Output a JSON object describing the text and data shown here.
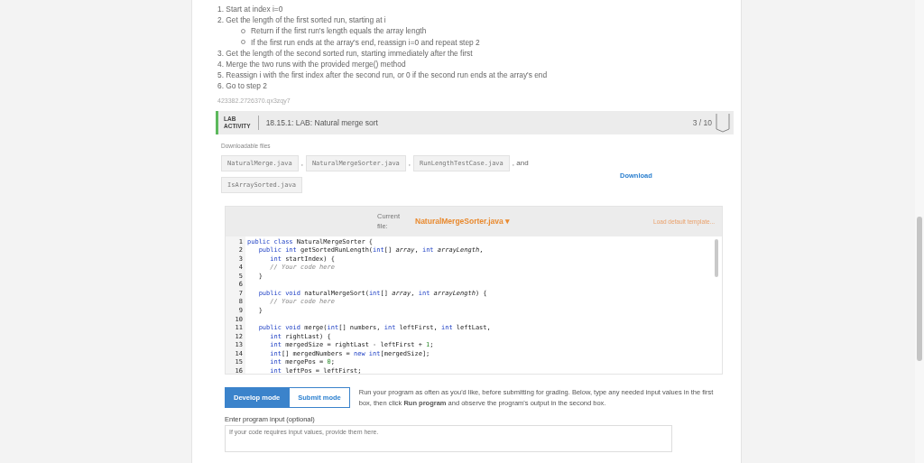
{
  "steps": [
    {
      "number": "1.",
      "text": "Start at index i=0"
    },
    {
      "number": "2.",
      "text": "Get the length of the first sorted run, starting at i",
      "sub": [
        "Return if the first run's length equals the array length",
        "If the first run ends at the array's end, reassign i=0 and repeat step 2"
      ]
    },
    {
      "number": "3.",
      "text": "Get the length of the second sorted run, starting immediately after the first"
    },
    {
      "number": "4.",
      "text": "Merge the two runs with the provided merge() method"
    },
    {
      "number": "5.",
      "text": "Reassign i with the first index after the second run, or 0 if the second run ends at the array's end"
    },
    {
      "number": "6.",
      "text": "Go to step 2"
    }
  ],
  "activity_id": "423382.2726370.qx3zqy7",
  "lab": {
    "badge_line1": "LAB",
    "badge_line2": "ACTIVITY",
    "title": "18.15.1: LAB: Natural merge sort",
    "score": "3 / 10"
  },
  "downloads": {
    "label": "Downloadable files",
    "files": [
      "NaturalMerge.java",
      "NaturalMergeSorter.java",
      "RunLengthTestCase.java",
      "IsArraySorted.java"
    ],
    "separators": [
      ",",
      ",",
      ", and"
    ],
    "button": "Download"
  },
  "editor": {
    "current_label": "Current file:",
    "file": "NaturalMergeSorter.java",
    "dropdown_caret": "▾",
    "load_template": "Load default template...",
    "lines": [
      {
        "number": "1",
        "tokens": [
          {
            "kind": "kw",
            "text": "public class "
          },
          {
            "kind": "plain",
            "text": "NaturalMergeSorter {"
          }
        ]
      },
      {
        "number": "2",
        "tokens": [
          {
            "kind": "kw",
            "text": "   public int "
          },
          {
            "kind": "plain",
            "text": "getSortedRunLength("
          },
          {
            "kind": "kw",
            "text": "int"
          },
          {
            "kind": "plain",
            "text": "[] "
          },
          {
            "kind": "var",
            "text": "array"
          },
          {
            "kind": "plain",
            "text": ", "
          },
          {
            "kind": "kw",
            "text": "int "
          },
          {
            "kind": "var",
            "text": "arrayLength"
          },
          {
            "kind": "plain",
            "text": ","
          }
        ]
      },
      {
        "number": "3",
        "tokens": [
          {
            "kind": "kw",
            "text": "      int "
          },
          {
            "kind": "plain",
            "text": "startIndex) {"
          }
        ]
      },
      {
        "number": "4",
        "tokens": [
          {
            "kind": "comment",
            "text": "      // Your code here"
          }
        ]
      },
      {
        "number": "5",
        "tokens": [
          {
            "kind": "plain",
            "text": "   }"
          }
        ]
      },
      {
        "number": "6"
      },
      {
        "number": "7",
        "tokens": [
          {
            "kind": "kw",
            "text": "   public void "
          },
          {
            "kind": "plain",
            "text": "naturalMergeSort("
          },
          {
            "kind": "kw",
            "text": "int"
          },
          {
            "kind": "plain",
            "text": "[] "
          },
          {
            "kind": "var",
            "text": "array"
          },
          {
            "kind": "plain",
            "text": ", "
          },
          {
            "kind": "kw",
            "text": "int "
          },
          {
            "kind": "var",
            "text": "arrayLength"
          },
          {
            "kind": "plain",
            "text": ") {"
          }
        ]
      },
      {
        "number": "8",
        "tokens": [
          {
            "kind": "comment",
            "text": "      // Your code here"
          }
        ]
      },
      {
        "number": "9",
        "tokens": [
          {
            "kind": "plain",
            "text": "   }"
          }
        ]
      },
      {
        "number": "10"
      },
      {
        "number": "11",
        "tokens": [
          {
            "kind": "kw",
            "text": "   public void "
          },
          {
            "kind": "plain",
            "text": "merge("
          },
          {
            "kind": "kw",
            "text": "int"
          },
          {
            "kind": "plain",
            "text": "[] numbers, "
          },
          {
            "kind": "kw",
            "text": "int "
          },
          {
            "kind": "plain",
            "text": "leftFirst, "
          },
          {
            "kind": "kw",
            "text": "int "
          },
          {
            "kind": "plain",
            "text": "leftLast,"
          }
        ]
      },
      {
        "number": "12",
        "tokens": [
          {
            "kind": "kw",
            "text": "      int "
          },
          {
            "kind": "plain",
            "text": "rightLast) {"
          }
        ]
      },
      {
        "number": "13",
        "tokens": [
          {
            "kind": "kw",
            "text": "      int "
          },
          {
            "kind": "plain",
            "text": "mergedSize = rightLast - leftFirst + "
          },
          {
            "kind": "num",
            "text": "1"
          },
          {
            "kind": "plain",
            "text": ";"
          }
        ]
      },
      {
        "number": "14",
        "tokens": [
          {
            "kind": "kw",
            "text": "      int"
          },
          {
            "kind": "plain",
            "text": "[] mergedNumbers = "
          },
          {
            "kind": "kw",
            "text": "new int"
          },
          {
            "kind": "plain",
            "text": "[mergedSize];"
          }
        ]
      },
      {
        "number": "15",
        "tokens": [
          {
            "kind": "kw",
            "text": "      int "
          },
          {
            "kind": "plain",
            "text": "mergePos = "
          },
          {
            "kind": "num",
            "text": "0"
          },
          {
            "kind": "plain",
            "text": ";"
          }
        ]
      },
      {
        "number": "16",
        "tokens": [
          {
            "kind": "kw",
            "text": "      int "
          },
          {
            "kind": "plain",
            "text": "leftPos = leftFirst;"
          }
        ]
      }
    ]
  },
  "modes": [
    {
      "label": "Develop mode",
      "selected": true
    },
    {
      "label": "Submit mode",
      "selected": false
    }
  ],
  "mode_help": "Run your program as often as you'd like, before submitting for grading. Below, type any needed input values in the first box, then click **Run program** and observe the program's output in the second box.",
  "input": {
    "label": "Enter program input (optional)",
    "placeholder": "If your code requires input values, provide them here."
  }
}
